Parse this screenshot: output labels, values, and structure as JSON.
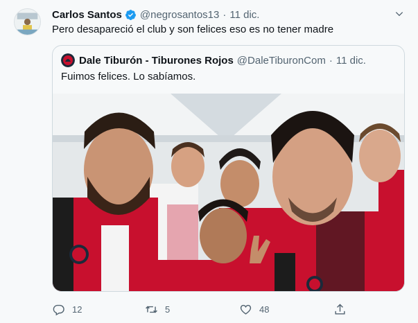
{
  "tweet": {
    "author": {
      "name": "Carlos Santos",
      "handle": "@negrosantos13",
      "verified": true
    },
    "separator": "·",
    "date": "11 dic.",
    "text": "Pero desapareció el club y son felices eso es no tener madre"
  },
  "quoted": {
    "author": {
      "name": "Dale Tiburón - Tiburones Rojos",
      "handle": "@DaleTiburonCom"
    },
    "separator": "·",
    "date": "11 dic.",
    "text": "Fuimos felices. Lo sabíamos."
  },
  "actions": {
    "reply_count": "12",
    "retweet_count": "5",
    "like_count": "48"
  },
  "icons": {
    "verified": "verified-badge-icon",
    "more": "chevron-down-icon",
    "reply": "comment-icon",
    "retweet": "retweet-icon",
    "like": "heart-icon",
    "share": "share-icon"
  },
  "colors": {
    "accent": "#1d9bf0",
    "secondary_text": "#536471",
    "border": "#cfd9de",
    "jersey_red": "#c8102e"
  }
}
